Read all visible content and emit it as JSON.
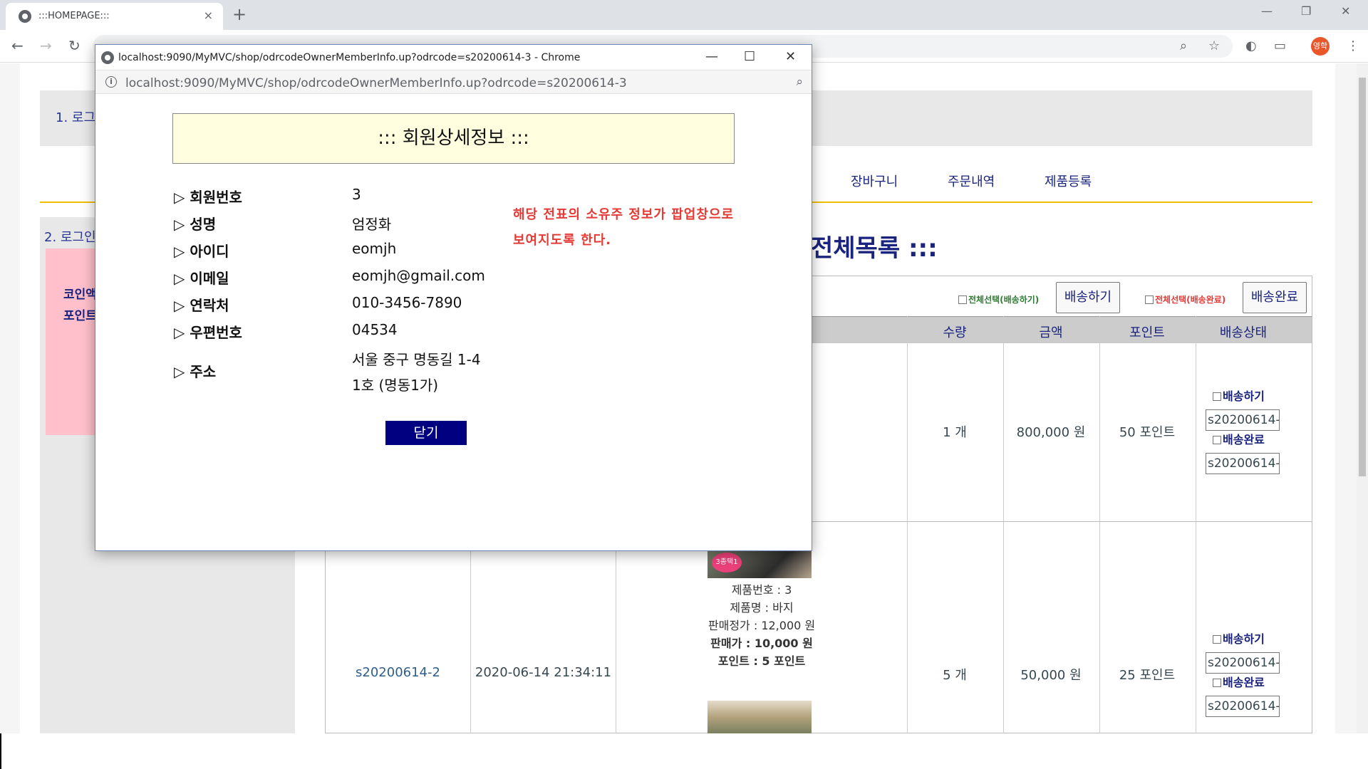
{
  "browser": {
    "tab_title": ":::HOMEPAGE:::",
    "tab_close": "×",
    "new_tab": "+",
    "profile_label": "영학"
  },
  "page": {
    "top_box_text": "1. 로그",
    "menu": [
      "장바구니",
      "주문내역",
      "제품등록"
    ],
    "sidebar_text": "2. 로그인",
    "pink_lines": [
      "코인액",
      "포인트"
    ],
    "list_title": "전체목록 :::",
    "controls": {
      "select_all_ship": "전체선택(배송하기)",
      "ship_button": "배송하기",
      "select_all_done": "전체선택(배송완료)",
      "done_button": "배송완료"
    },
    "columns": [
      "수량",
      "금액",
      "포인트",
      "배송상태"
    ],
    "rows": [
      {
        "qty": "1 개",
        "amount": "800,000 원",
        "point": "50 포인트",
        "partial_strike": "원",
        "partial_red": "원",
        "ship_label": "배송하기",
        "ship_code": "s20200614-",
        "done_label": "배송완료",
        "done_code": "s20200614-"
      },
      {
        "order_code": "s20200614-2",
        "order_date": "2020-06-14 21:34:11",
        "product_badge": "3종택1",
        "product_no": "제품번호 : 3",
        "product_name": "제품명 : 바지",
        "list_price": "판매정가 : 12,000 원",
        "sale_price": "판매가 : 10,000 원",
        "product_point": "포인트 : 5 포인트",
        "qty": "5 개",
        "amount": "50,000 원",
        "point": "25 포인트",
        "ship_label": "배송하기",
        "ship_code": "s20200614-",
        "done_label": "배송완료",
        "done_code": "s20200614-"
      }
    ]
  },
  "popup": {
    "window_title": "localhost:9090/MyMVC/shop/odrcodeOwnerMemberInfo.up?odrcode=s20200614-3 - Chrome",
    "url": "localhost:9090/MyMVC/shop/odrcodeOwnerMemberInfo.up?odrcode=s20200614-3",
    "heading": "::: 회원상세정보 :::",
    "fields": [
      {
        "label": "▷ 회원번호",
        "value": "3"
      },
      {
        "label": "▷ 성명",
        "value": "엄정화"
      },
      {
        "label": "▷ 아이디",
        "value": "eomjh"
      },
      {
        "label": "▷ 이메일",
        "value": "eomjh@gmail.com"
      },
      {
        "label": "▷ 연락처",
        "value": "010-3456-7890"
      },
      {
        "label": "▷ 우편번호",
        "value": "04534"
      }
    ],
    "address_label": "▷ 주소",
    "address_line1": "서울 중구 명동길 1-4",
    "address_line2": "1호 (명동1가)",
    "note_line1": "해당 전표의 소유주 정보가 팝업창으로",
    "note_line2": "보여지도록 한다.",
    "close_button": "닫기"
  }
}
